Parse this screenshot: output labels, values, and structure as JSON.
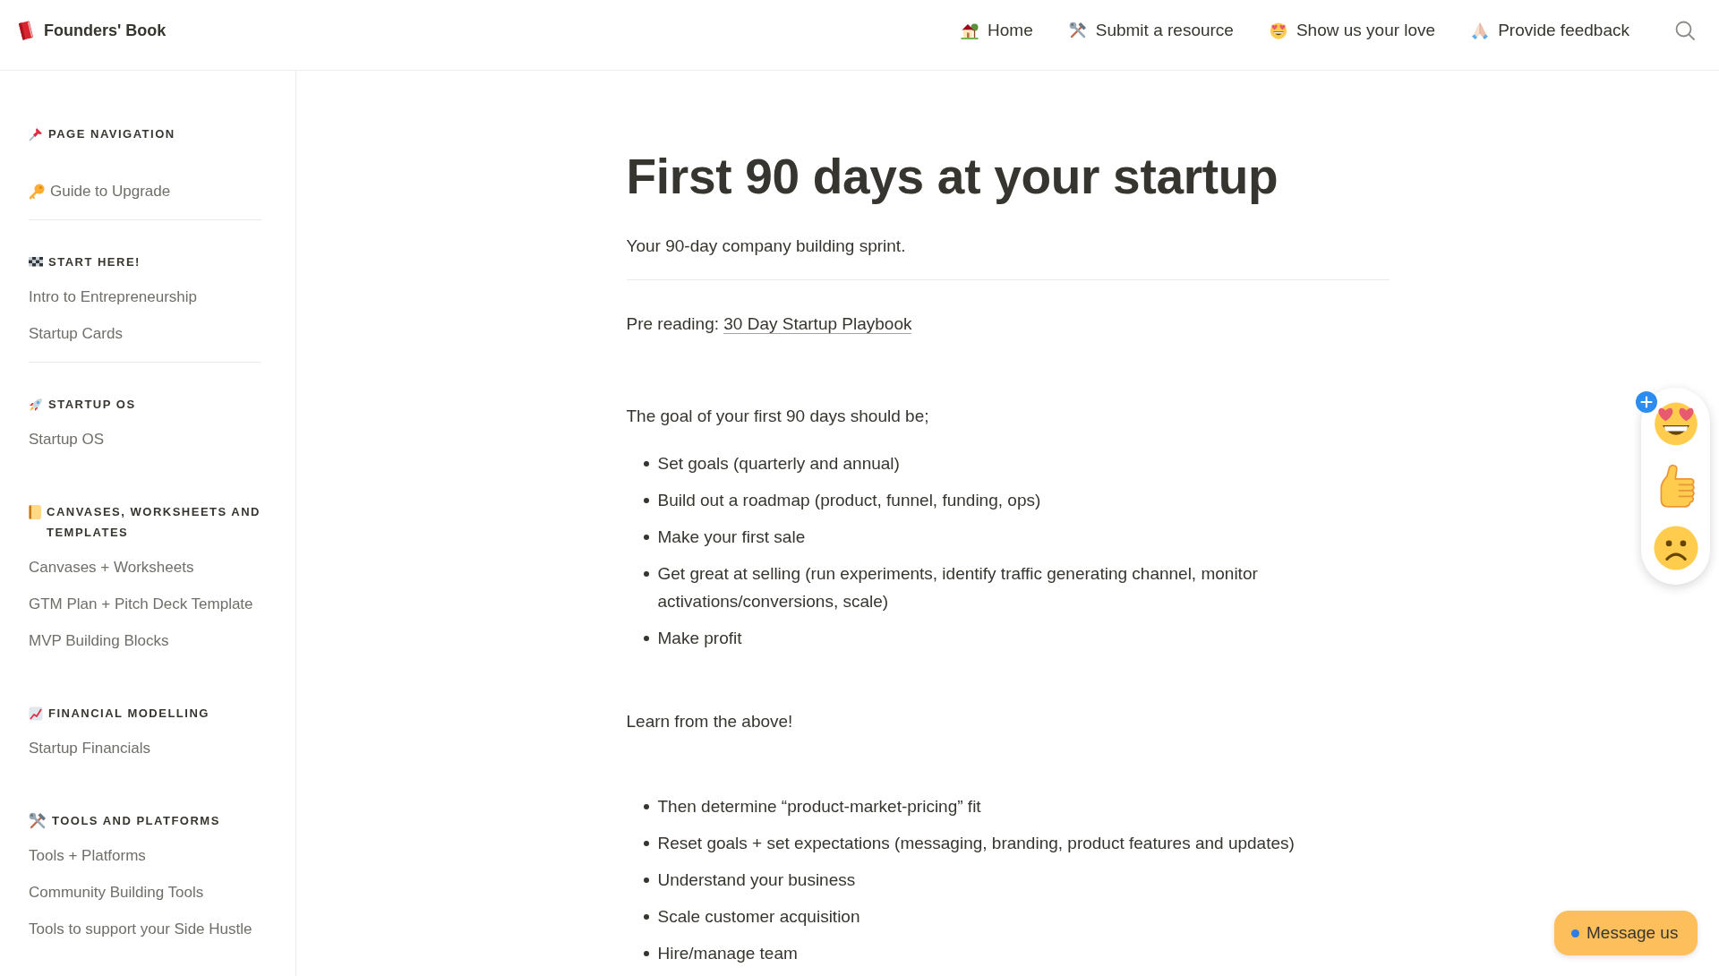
{
  "header": {
    "logo": "Founders' Book",
    "nav": [
      {
        "label": "Home"
      },
      {
        "label": "Submit a resource"
      },
      {
        "label": "Show us your love"
      },
      {
        "label": "Provide feedback"
      }
    ]
  },
  "sidebar": {
    "sections": [
      {
        "title": "PAGE NAVIGATION",
        "divider": true,
        "items": [
          {
            "label": "Guide to Upgrade"
          }
        ]
      },
      {
        "title": "START HERE!",
        "divider": true,
        "items": [
          {
            "label": "Intro to Entrepreneurship"
          },
          {
            "label": "Startup Cards"
          }
        ]
      },
      {
        "title": "STARTUP OS",
        "divider": false,
        "items": [
          {
            "label": "Startup OS"
          }
        ]
      },
      {
        "title": "CANVASES, WORKSHEETS AND TEMPLATES",
        "divider": false,
        "items": [
          {
            "label": "Canvases + Worksheets"
          },
          {
            "label": "GTM Plan + Pitch Deck Template"
          },
          {
            "label": "MVP Building Blocks"
          }
        ]
      },
      {
        "title": "FINANCIAL MODELLING",
        "divider": false,
        "items": [
          {
            "label": "Startup Financials"
          }
        ]
      },
      {
        "title": "TOOLS AND PLATFORMS",
        "divider": false,
        "items": [
          {
            "label": "Tools + Platforms"
          },
          {
            "label": "Community Building Tools"
          },
          {
            "label": "Tools to support your Side Hustle"
          }
        ]
      }
    ]
  },
  "article": {
    "title": "First 90 days at your startup",
    "subtitle": "Your 90-day company building sprint.",
    "pre_reading": {
      "label": "Pre reading:",
      "link": "30 Day Startup Playbook"
    },
    "blocks": [
      {
        "kind": "paragraph",
        "text": "The goal of your first 90 days should be;"
      },
      {
        "kind": "list",
        "items": [
          "Set goals (quarterly and annual)",
          "Build out a roadmap (product, funnel, funding, ops)",
          "Make your first sale",
          "Get great at selling (run experiments, identify traffic generating channel, monitor activations/conversions, scale)",
          "Make profit"
        ]
      },
      {
        "kind": "paragraph",
        "text": "Learn from the above!"
      },
      {
        "kind": "list",
        "items": [
          "Then determine “product-market-pricing” fit",
          "Reset goals + set expectations (messaging, branding, product features and updates)",
          "Understand your business",
          "Scale customer acquisition",
          "Hire/manage team"
        ]
      }
    ]
  },
  "chat_button": {
    "label": "Message us"
  }
}
